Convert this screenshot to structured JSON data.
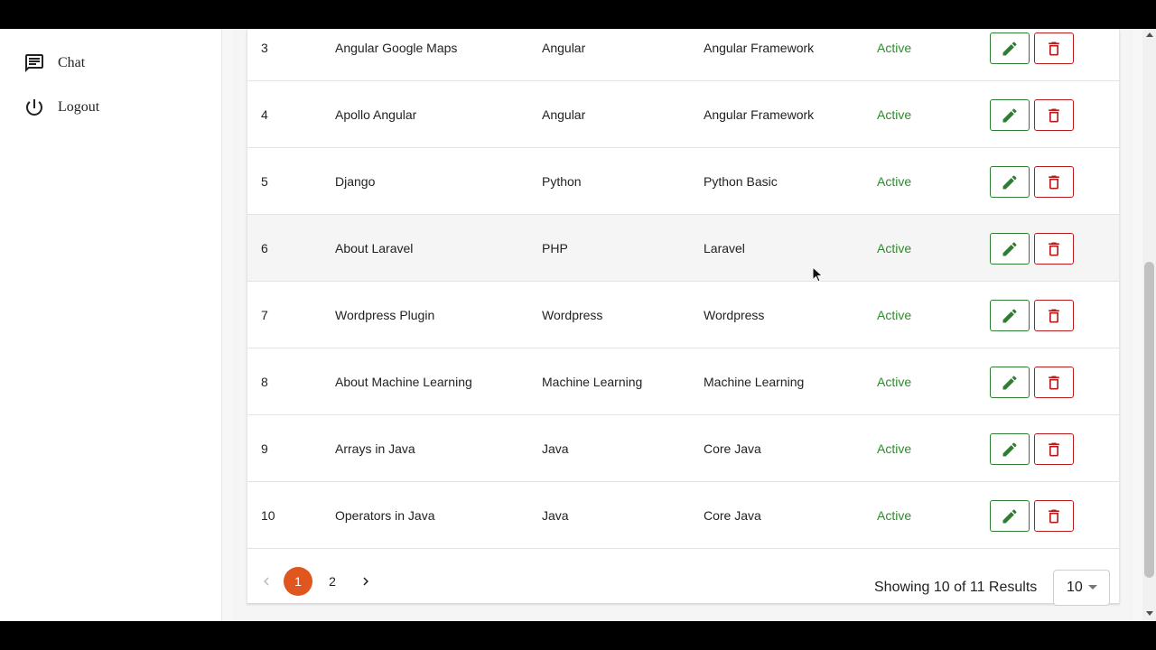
{
  "sidebar": {
    "items": [
      {
        "label": "Chat",
        "icon": "chat-icon"
      },
      {
        "label": "Logout",
        "icon": "power-icon"
      }
    ]
  },
  "table": {
    "rows": [
      {
        "id": "3",
        "title": "Angular Google Maps",
        "category": "Angular",
        "subcategory": "Angular Framework",
        "status": "Active"
      },
      {
        "id": "4",
        "title": "Apollo Angular",
        "category": "Angular",
        "subcategory": "Angular Framework",
        "status": "Active"
      },
      {
        "id": "5",
        "title": "Django",
        "category": "Python",
        "subcategory": "Python Basic",
        "status": "Active"
      },
      {
        "id": "6",
        "title": "About Laravel",
        "category": "PHP",
        "subcategory": "Laravel",
        "status": "Active"
      },
      {
        "id": "7",
        "title": "Wordpress Plugin",
        "category": "Wordpress",
        "subcategory": "Wordpress",
        "status": "Active"
      },
      {
        "id": "8",
        "title": "About Machine Learning",
        "category": "Machine Learning",
        "subcategory": "Machine Learning",
        "status": "Active"
      },
      {
        "id": "9",
        "title": "Arrays in Java",
        "category": "Java",
        "subcategory": "Core Java",
        "status": "Active"
      },
      {
        "id": "10",
        "title": "Operators in Java",
        "category": "Java",
        "subcategory": "Core Java",
        "status": "Active"
      }
    ],
    "hovered_row_id": "6"
  },
  "pagination": {
    "pages": [
      "1",
      "2"
    ],
    "current_page": "1",
    "results_text": "Showing 10 of 11 Results",
    "per_page": "10"
  },
  "colors": {
    "status_active": "#2e8b2e",
    "edit_accent": "#2e7d32",
    "delete_accent": "#b71c1c",
    "active_page": "#e0561f"
  }
}
